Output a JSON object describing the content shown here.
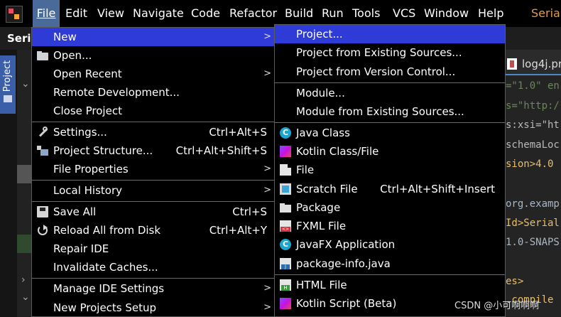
{
  "menubar": {
    "items": [
      "File",
      "Edit",
      "View",
      "Navigate",
      "Code",
      "Refactor",
      "Build",
      "Run",
      "Tools",
      "VCS",
      "Window",
      "Help"
    ],
    "window_title": "Seriali"
  },
  "nav": {
    "project_name": "Seria"
  },
  "tool_window": {
    "project_label": "Project"
  },
  "editor": {
    "tab_label": "log4j.pr",
    "lines": [
      "=\"1.0\" en",
      "s=\"http:/",
      "s:xsi=\"ht",
      "schemaLoc",
      "sion>4.0",
      "",
      "org.examp",
      "Id>Serial",
      "1.0-SNAPS",
      "",
      "es>",
      ".compile"
    ]
  },
  "file_menu": {
    "items": [
      {
        "label": "New",
        "submenu": true
      },
      {
        "label": "Open..."
      },
      {
        "label": "Open Recent",
        "submenu": true
      },
      {
        "label": "Remote Development..."
      },
      {
        "label": "Close Project"
      },
      {
        "label": "Settings...",
        "shortcut": "Ctrl+Alt+S"
      },
      {
        "label": "Project Structure...",
        "shortcut": "Ctrl+Alt+Shift+S"
      },
      {
        "label": "File Properties",
        "submenu": true
      },
      {
        "label": "Local History",
        "submenu": true
      },
      {
        "label": "Save All",
        "shortcut": "Ctrl+S"
      },
      {
        "label": "Reload All from Disk",
        "shortcut": "Ctrl+Alt+Y"
      },
      {
        "label": "Repair IDE"
      },
      {
        "label": "Invalidate Caches..."
      },
      {
        "label": "Manage IDE Settings",
        "submenu": true
      },
      {
        "label": "New Projects Setup",
        "submenu": true
      }
    ]
  },
  "new_menu": {
    "items": [
      {
        "label": "Project..."
      },
      {
        "label": "Project from Existing Sources..."
      },
      {
        "label": "Project from Version Control..."
      },
      {
        "label": "Module..."
      },
      {
        "label": "Module from Existing Sources..."
      },
      {
        "label": "Java Class"
      },
      {
        "label": "Kotlin Class/File"
      },
      {
        "label": "File"
      },
      {
        "label": "Scratch File",
        "shortcut": "Ctrl+Alt+Shift+Insert"
      },
      {
        "label": "Package"
      },
      {
        "label": "FXML File"
      },
      {
        "label": "JavaFX Application"
      },
      {
        "label": "package-info.java"
      },
      {
        "label": "HTML File"
      },
      {
        "label": "Kotlin Script (Beta)"
      }
    ]
  },
  "watermark": "CSDN @小可啊啊啊",
  "colors": {
    "menu_highlight": "#2f3bd6",
    "active_menu": "#4a6b9a"
  }
}
